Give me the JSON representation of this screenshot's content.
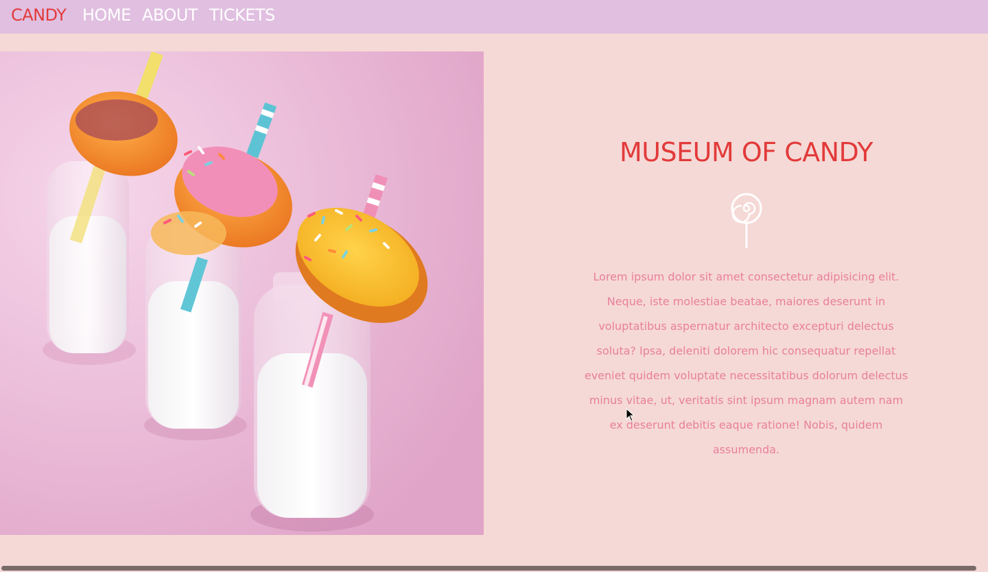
{
  "navbar": {
    "brand": "CANDY",
    "links": [
      "HOME",
      "ABOUT",
      "TICKETS"
    ]
  },
  "hero": {
    "title": "MUSEUM OF CANDY",
    "icon": "lollipop-icon",
    "text": "Lorem ipsum dolor sit amet consectetur adipisicing elit. Neque, iste molestiae beatae, maiores deserunt in voluptatibus aspernatur architecto excepturi delectus soluta? Ipsa, deleniti dolorem hic consequatur repellat eveniet quidem voluptate necessitatibus dolorum delectus minus vitae, ut, veritatis sint ipsum magnam autem nam ex deserunt debitis eaque ratione! Nobis, quidem assumenda."
  },
  "colors": {
    "navbar_bg": "#e0bfe0",
    "page_bg": "#f5d9d6",
    "brand": "#e23a3a",
    "body_text": "#e8809a"
  }
}
